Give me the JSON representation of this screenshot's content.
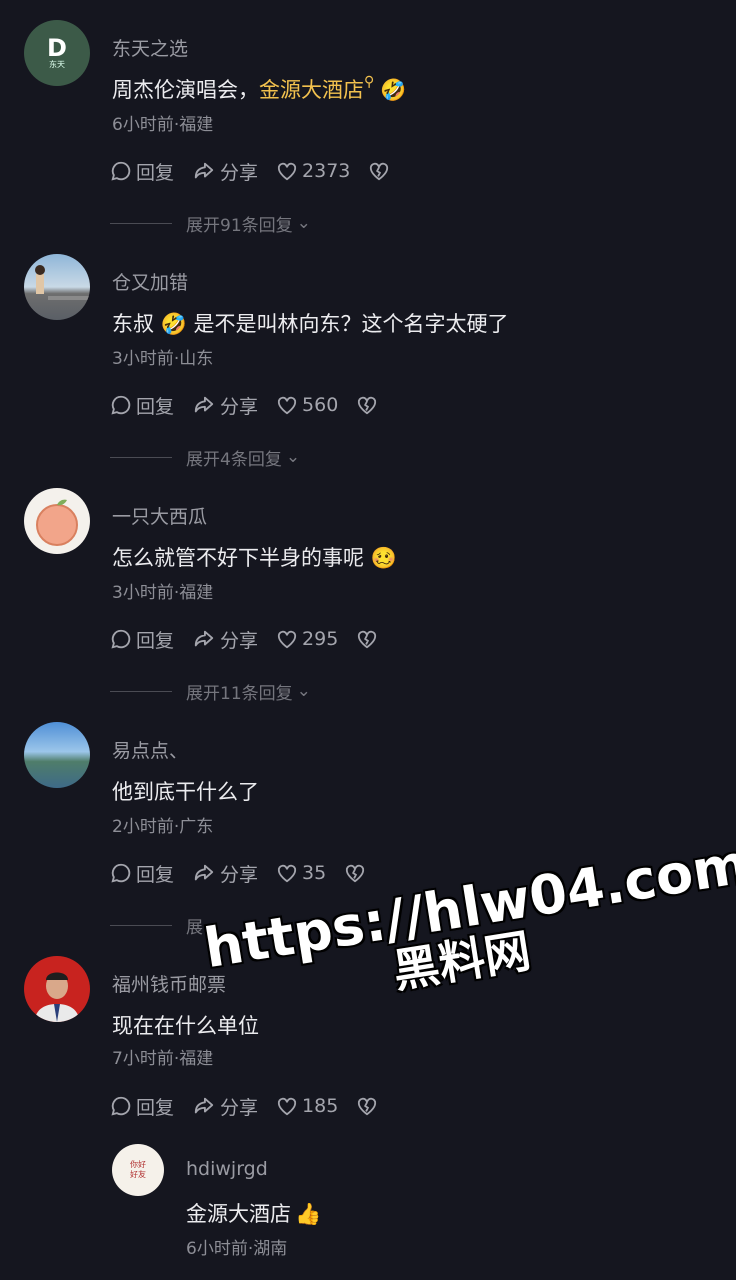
{
  "comments": [
    {
      "user": "东天之选",
      "text_a": "周杰伦演唱会，",
      "highlight": "金源大酒店",
      "text_b": "",
      "emoji": "🤣",
      "meta": "6小时前·福建",
      "reply": "回复",
      "share": "分享",
      "likes": "2373",
      "expand": "展开91条回复"
    },
    {
      "user": "仓又加错",
      "text_a": "东叔 ",
      "emoji": "🤣",
      "text_b": " 是不是叫林向东？这个名字太硬了",
      "meta": "3小时前·山东",
      "reply": "回复",
      "share": "分享",
      "likes": "560",
      "expand": "展开4条回复"
    },
    {
      "user": "一只大西瓜",
      "text_a": "怎么就管不好下半身的事呢 ",
      "emoji": "🥴",
      "meta": "3小时前·福建",
      "reply": "回复",
      "share": "分享",
      "likes": "295",
      "expand": "展开11条回复"
    },
    {
      "user": "易点点、",
      "text_a": "他到底干什么了",
      "meta": "2小时前·广东",
      "reply": "回复",
      "share": "分享",
      "likes": "35",
      "expand": "展"
    },
    {
      "user": "福州钱币邮票",
      "text_a": "现在在什么单位",
      "meta": "7小时前·福建",
      "reply": "回复",
      "share": "分享",
      "likes": "185"
    }
  ],
  "subreply": {
    "user": "hdiwjrgd",
    "text": "金源大酒店",
    "emoji": "👍",
    "meta": "6小时前·湖南"
  },
  "avatar_letter": "D",
  "avatar_sub": "东天",
  "avatar_sub2": "你好\n好友",
  "watermark": {
    "url": "https://hlw04.com",
    "name": "黑料网"
  },
  "colors": {
    "background": "#15161f",
    "highlight": "#f2c14e"
  }
}
